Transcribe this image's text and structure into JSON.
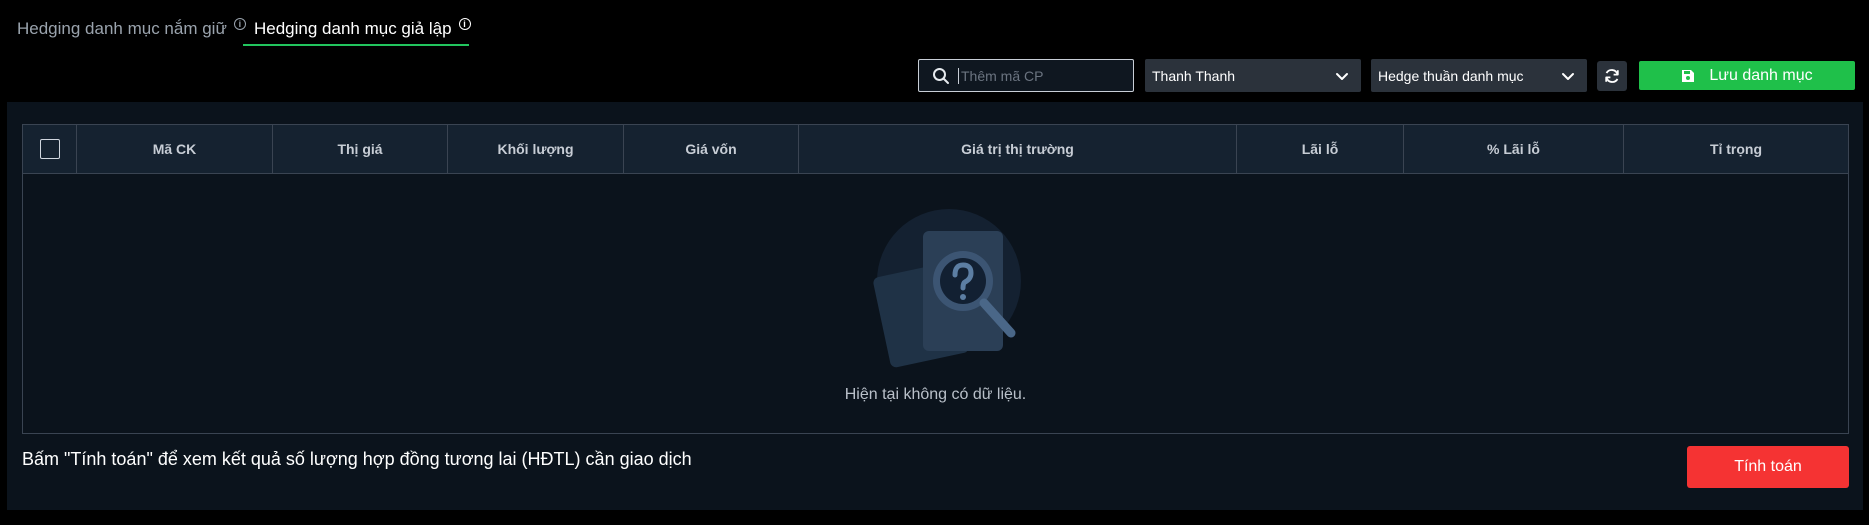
{
  "tabs": [
    {
      "label": "Hedging danh mục nắm giữ",
      "active": false
    },
    {
      "label": "Hedging danh mục giả lập",
      "active": true
    }
  ],
  "toolbar": {
    "search_placeholder": "Thêm mã CP",
    "user_select": "Thanh Thanh",
    "mode_select": "Hedge thuần danh mục",
    "save_label": "Lưu danh mục"
  },
  "table": {
    "columns": [
      "Mã CK",
      "Thị giá",
      "Khối lượng",
      "Giá vốn",
      "Giá trị thị trường",
      "Lãi lỗ",
      "% Lãi lỗ",
      "Tỉ trọng"
    ],
    "empty_text": "Hiện tại không có dữ liệu."
  },
  "footer": {
    "hint": "Bấm \"Tính toán\" để xem kết quả số lượng hợp đồng tương lai (HĐTL) cần giao dịch",
    "calc_label": "Tính toán"
  },
  "colors": {
    "accent_green": "#1fc04a",
    "danger_red": "#f53333",
    "panel_bg": "#0b131c",
    "header_bg": "#152230"
  },
  "icons": {
    "tab_info": "info-icon",
    "search": "search-icon",
    "dropdown": "chevron-down-icon",
    "refresh": "refresh-icon",
    "save": "floppy-disk-icon",
    "empty": "magnifier-question-icon"
  }
}
